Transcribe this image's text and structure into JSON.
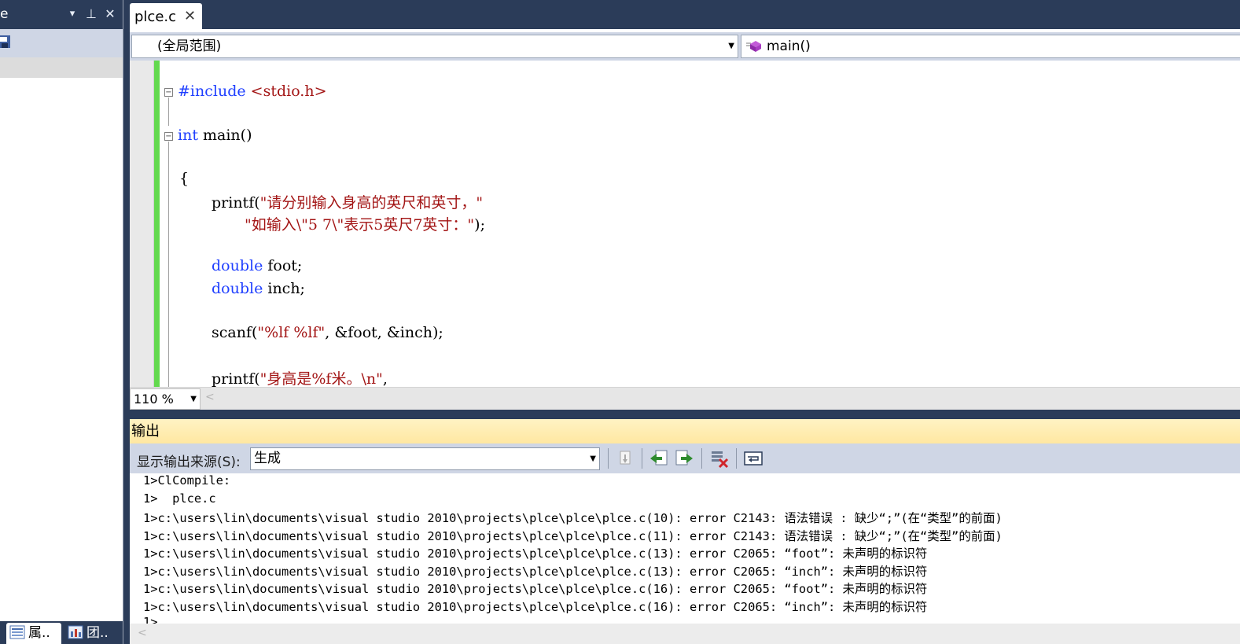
{
  "left_panel": {
    "title": "e",
    "dropdown_glyph": "▾",
    "pin_glyph": "⊥",
    "close_glyph": "✕",
    "tabs": [
      {
        "label": "属.."
      },
      {
        "label": "团.."
      }
    ]
  },
  "document": {
    "tab_label": "plce.c",
    "close_glyph": "✕"
  },
  "navbar": {
    "scope": "(全局范围)",
    "function": "main()"
  },
  "editor": {
    "lines": {
      "l1_kw": "#include",
      "l1_str": " <stdio.h>",
      "l2_kw": "int",
      "l2_rest": " main()",
      "l3": "{",
      "l4_fn": "printf(",
      "l4_str": "\"请分别输入身高的英尺和英寸，\"",
      "l5_str": "\"如输入\\\"5 7\\\"表示5英尺7英寸：\"",
      "l5_rest": ");",
      "l6_kw": "double",
      "l6_rest": " foot;",
      "l7_kw": "double",
      "l7_rest": " inch;",
      "l8_fn": "scanf(",
      "l8_str": "\"%lf %lf\"",
      "l8_rest": ", &foot, &inch);",
      "l9_fn": "printf(",
      "l9_str": "\"身高是%f米。\\n\"",
      "l9_rest": ","
    },
    "zoom": "110 %"
  },
  "output": {
    "title": "输出",
    "source_label": "显示输出来源(S):",
    "source_value": "生成",
    "lines": [
      "1>ClCompile:",
      "1>  plce.c",
      "1>c:\\users\\lin\\documents\\visual studio 2010\\projects\\plce\\plce\\plce.c(10): error C2143: 语法错误 : 缺少“;”(在“类型”的前面)",
      "1>c:\\users\\lin\\documents\\visual studio 2010\\projects\\plce\\plce\\plce.c(11): error C2143: 语法错误 : 缺少“;”(在“类型”的前面)",
      "1>c:\\users\\lin\\documents\\visual studio 2010\\projects\\plce\\plce\\plce.c(13): error C2065: “foot”: 未声明的标识符",
      "1>c:\\users\\lin\\documents\\visual studio 2010\\projects\\plce\\plce\\plce.c(13): error C2065: “inch”: 未声明的标识符",
      "1>c:\\users\\lin\\documents\\visual studio 2010\\projects\\plce\\plce\\plce.c(16): error C2065: “foot”: 未声明的标识符",
      "1>c:\\users\\lin\\documents\\visual studio 2010\\projects\\plce\\plce\\plce.c(16): error C2065: “inch”: 未声明的标识符",
      "1>"
    ]
  },
  "colors": {
    "chrome_dark": "#2b3c59",
    "toolbar": "#cfd6e5",
    "change_bar": "#63d94e",
    "keyword": "#1f3fff",
    "string": "#a31515",
    "output_title": "#ffe7a1"
  },
  "icons": {
    "save": "save-icon",
    "method": "method-icon",
    "goto_location": "goto-location-icon",
    "prev_message": "previous-message-icon",
    "next_message": "next-message-icon",
    "clear_all": "clear-all-icon",
    "word_wrap": "word-wrap-icon"
  }
}
